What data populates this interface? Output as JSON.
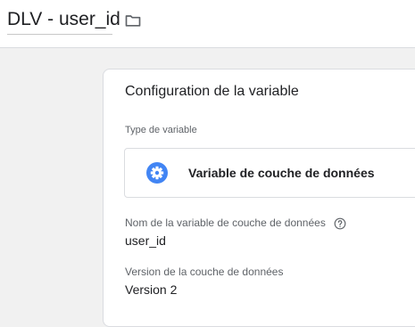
{
  "header": {
    "variable_name": "DLV - user_id"
  },
  "card": {
    "title": "Configuration de la variable",
    "type_label": "Type de variable",
    "type_name": "Variable de couche de données",
    "fields": [
      {
        "label": "Nom de la variable de couche de données",
        "value": "user_id"
      },
      {
        "label": "Version de la couche de données",
        "value": "Version 2"
      }
    ]
  },
  "colors": {
    "accent_blue": "#4285f4",
    "text_primary": "#202124",
    "text_secondary": "#5f6368"
  },
  "icons": {
    "folder": "folder-icon",
    "variable_type": "gear-icon",
    "help": "help-circle-icon"
  }
}
